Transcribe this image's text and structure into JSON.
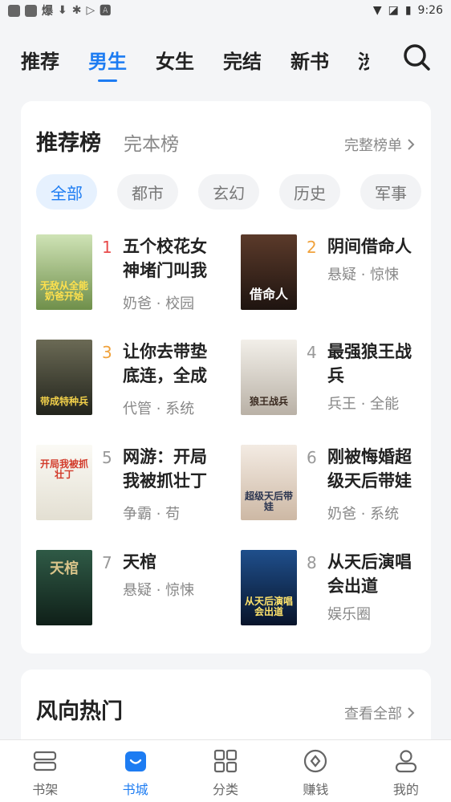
{
  "status_bar": {
    "left_text": "爆",
    "time": "9:26"
  },
  "top_tabs": [
    "推荐",
    "男生",
    "女生",
    "完结",
    "新书",
    "涉"
  ],
  "active_tab_index": 1,
  "ranking": {
    "title": "推荐榜",
    "alt_title": "完本榜",
    "more_label": "完整榜单",
    "filters": [
      "全部",
      "都市",
      "玄幻",
      "历史",
      "军事"
    ],
    "active_filter_index": 0,
    "books": [
      {
        "rank": "1",
        "name": "五个校花女神堵门叫我",
        "tags": "奶爸 · 校园",
        "cover_text": "无敌从全能奶爸开始",
        "cover_color": "#8fae6b"
      },
      {
        "rank": "2",
        "name": "阴间借命人",
        "tags": "悬疑 · 惊悚",
        "cover_text": "借命人",
        "cover_color": "#3a2a22"
      },
      {
        "rank": "3",
        "name": "让你去带垫底连，全成",
        "tags": "代管 · 系统",
        "cover_text": "带成特种兵",
        "cover_color": "#3b3d30"
      },
      {
        "rank": "4",
        "name": "最强狼王战兵",
        "tags": "兵王 · 全能",
        "cover_text": "狼王战兵",
        "cover_color": "#d9d4cc"
      },
      {
        "rank": "5",
        "name": "网游：开局我被抓壮丁",
        "tags": "争霸 · 苟",
        "cover_text": "开局我被抓壮丁",
        "cover_color": "#f1efe8"
      },
      {
        "rank": "6",
        "name": "刚被悔婚超级天后带娃",
        "tags": "奶爸 · 系统",
        "cover_text": "超级天后带娃",
        "cover_color": "#e8ddd3"
      },
      {
        "rank": "7",
        "name": "天棺",
        "tags": "悬疑 · 惊悚",
        "cover_text": "天棺",
        "cover_color": "#1d3a2f"
      },
      {
        "rank": "8",
        "name": "从天后演唱会出道",
        "tags": "娱乐圈",
        "cover_text": "从天后演唱会出道",
        "cover_color": "#0e1f3d"
      }
    ]
  },
  "trending": {
    "title": "风向热门",
    "more_label": "查看全部"
  },
  "bottom_nav": [
    {
      "label": "书架",
      "icon": "bookshelf-icon"
    },
    {
      "label": "书城",
      "icon": "bookstore-icon"
    },
    {
      "label": "分类",
      "icon": "category-icon"
    },
    {
      "label": "赚钱",
      "icon": "earn-icon"
    },
    {
      "label": "我的",
      "icon": "profile-icon"
    }
  ],
  "active_bottom_index": 1,
  "colors": {
    "accent": "#1d7cf2",
    "rank_top": "#e84b4b",
    "rank_mid": "#f0a23c"
  }
}
